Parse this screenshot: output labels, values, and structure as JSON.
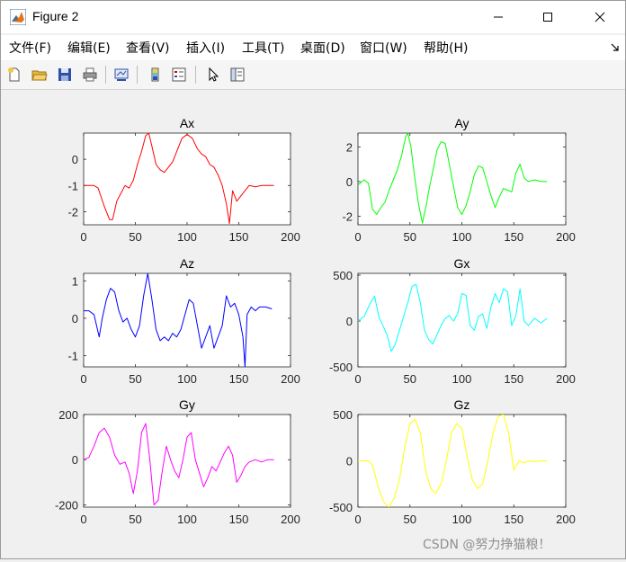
{
  "window": {
    "title": "Figure 2"
  },
  "menu": [
    "文件(F)",
    "编辑(E)",
    "查看(V)",
    "插入(I)",
    "工具(T)",
    "桌面(D)",
    "窗口(W)",
    "帮助(H)"
  ],
  "toolbar": [
    "new-figure-icon",
    "open-icon",
    "save-icon",
    "print-icon",
    "link-plot-icon",
    "insert-colorbar-icon",
    "insert-legend-icon",
    "edit-plot-arrow-icon",
    "property-inspector-icon"
  ],
  "watermark": "CSDN @努力挣猫粮！",
  "chart_data": [
    {
      "type": "line",
      "title": "Ax",
      "color": "#ff0000",
      "xlim": [
        0,
        200
      ],
      "ylim": [
        -2.5,
        1
      ],
      "xticks": [
        0,
        50,
        100,
        150,
        200
      ],
      "yticks": [
        -2,
        -1,
        0
      ],
      "x": [
        0,
        10,
        14,
        20,
        25,
        28,
        32,
        36,
        40,
        44,
        48,
        52,
        56,
        60,
        63,
        66,
        70,
        74,
        78,
        82,
        86,
        90,
        95,
        100,
        105,
        110,
        114,
        118,
        122,
        126,
        130,
        134,
        138,
        141,
        144,
        148,
        152,
        156,
        160,
        166,
        172,
        178,
        184
      ],
      "y": [
        -1,
        -1,
        -1.1,
        -1.8,
        -2.3,
        -2.3,
        -1.6,
        -1.3,
        -1,
        -1.1,
        -0.8,
        -0.2,
        0.3,
        0.9,
        1,
        0.5,
        -0.2,
        -0.4,
        -0.5,
        -0.3,
        -0.1,
        0.3,
        0.8,
        0.95,
        0.8,
        0.4,
        0.2,
        0.1,
        -0.2,
        -0.3,
        -0.6,
        -1,
        -1.7,
        -2.45,
        -1.2,
        -1.6,
        -1.4,
        -1.2,
        -1,
        -1.05,
        -1,
        -1,
        -1
      ]
    },
    {
      "type": "line",
      "title": "Ay",
      "color": "#00ff00",
      "xlim": [
        0,
        200
      ],
      "ylim": [
        -2.5,
        2.8
      ],
      "xticks": [
        0,
        50,
        100,
        150,
        200
      ],
      "yticks": [
        -2,
        0,
        2
      ],
      "x": [
        0,
        6,
        10,
        14,
        18,
        22,
        26,
        30,
        34,
        38,
        42,
        46,
        48,
        51,
        54,
        58,
        62,
        66,
        68,
        72,
        76,
        80,
        84,
        88,
        92,
        96,
        100,
        104,
        108,
        112,
        116,
        120,
        124,
        128,
        132,
        136,
        140,
        144,
        148,
        152,
        156,
        160,
        164,
        170,
        176,
        182
      ],
      "y": [
        -0.2,
        0.1,
        -0.1,
        -1.6,
        -1.9,
        -1.5,
        -1.2,
        -0.5,
        0.1,
        0.7,
        1.5,
        2.6,
        2.8,
        2,
        0.5,
        -1.2,
        -2.4,
        -1.3,
        -0.6,
        0.6,
        1.8,
        2.3,
        2.2,
        1,
        -0.3,
        -1.5,
        -1.9,
        -1.4,
        -0.6,
        0.4,
        0.9,
        0.8,
        0,
        -0.8,
        -1.5,
        -0.9,
        -0.4,
        -0.5,
        -0.6,
        0.5,
        1,
        0.2,
        0,
        0.1,
        0,
        0
      ]
    },
    {
      "type": "line",
      "title": "Az",
      "color": "#0000ff",
      "xlim": [
        0,
        200
      ],
      "ylim": [
        -1.3,
        1.2
      ],
      "xticks": [
        0,
        50,
        100,
        150,
        200
      ],
      "yticks": [
        -1,
        0,
        1
      ],
      "x": [
        0,
        5,
        10,
        15,
        18,
        22,
        26,
        30,
        34,
        38,
        42,
        46,
        50,
        54,
        58,
        62,
        66,
        70,
        74,
        78,
        82,
        86,
        90,
        94,
        98,
        102,
        106,
        110,
        114,
        118,
        122,
        126,
        130,
        134,
        138,
        142,
        146,
        150,
        154,
        156,
        158,
        162,
        166,
        170,
        176,
        182
      ],
      "y": [
        0.2,
        0.2,
        0.1,
        -0.5,
        0,
        0.5,
        0.8,
        0.7,
        0.2,
        -0.1,
        0,
        -0.3,
        -0.5,
        -0.2,
        0.6,
        1.2,
        0.5,
        -0.3,
        -0.6,
        -0.5,
        -0.6,
        -0.4,
        -0.5,
        -0.3,
        0.1,
        0.5,
        0.4,
        -0.2,
        -0.8,
        -0.5,
        -0.2,
        -0.8,
        -0.5,
        -0.2,
        0.6,
        0.3,
        0.4,
        0.1,
        -0.5,
        -1.3,
        0.1,
        0.3,
        0.2,
        0.3,
        0.3,
        0.25
      ]
    },
    {
      "type": "line",
      "title": "Gx",
      "color": "#00ffff",
      "xlim": [
        0,
        200
      ],
      "ylim": [
        -500,
        520
      ],
      "xticks": [
        0,
        50,
        100,
        150,
        200
      ],
      "yticks": [
        -500,
        0,
        500
      ],
      "x": [
        0,
        6,
        12,
        16,
        20,
        24,
        28,
        32,
        36,
        40,
        44,
        48,
        52,
        56,
        60,
        64,
        68,
        72,
        76,
        80,
        84,
        88,
        92,
        96,
        100,
        104,
        108,
        112,
        116,
        120,
        124,
        128,
        132,
        136,
        140,
        144,
        148,
        152,
        156,
        160,
        164,
        170,
        176,
        182
      ],
      "y": [
        0,
        50,
        200,
        270,
        50,
        -50,
        -150,
        -330,
        -250,
        -100,
        50,
        200,
        380,
        400,
        200,
        -100,
        -200,
        -250,
        -150,
        -50,
        30,
        60,
        0,
        80,
        300,
        280,
        -50,
        -100,
        50,
        80,
        -80,
        150,
        300,
        200,
        350,
        320,
        -50,
        60,
        350,
        0,
        -50,
        30,
        -20,
        30
      ]
    },
    {
      "type": "line",
      "title": "Gy",
      "color": "#ff00ff",
      "xlim": [
        0,
        200
      ],
      "ylim": [
        -210,
        200
      ],
      "xticks": [
        0,
        50,
        100,
        150,
        200
      ],
      "yticks": [
        -200,
        0,
        200
      ],
      "x": [
        0,
        5,
        10,
        15,
        20,
        25,
        30,
        35,
        40,
        44,
        48,
        52,
        56,
        60,
        64,
        68,
        72,
        76,
        80,
        84,
        88,
        92,
        96,
        100,
        104,
        108,
        112,
        116,
        120,
        124,
        128,
        132,
        136,
        140,
        144,
        148,
        152,
        156,
        160,
        166,
        172,
        178,
        184
      ],
      "y": [
        0,
        10,
        60,
        120,
        140,
        100,
        20,
        -20,
        -10,
        -60,
        -150,
        -50,
        120,
        160,
        0,
        -200,
        -180,
        -50,
        60,
        0,
        -50,
        -80,
        0,
        100,
        120,
        0,
        -60,
        -120,
        -80,
        -30,
        -50,
        -10,
        30,
        60,
        20,
        -100,
        -70,
        -30,
        -10,
        0,
        -10,
        0,
        0
      ]
    },
    {
      "type": "line",
      "title": "Gz",
      "color": "#ffff00",
      "xlim": [
        0,
        200
      ],
      "ylim": [
        -500,
        500
      ],
      "xticks": [
        0,
        50,
        100,
        150,
        200
      ],
      "yticks": [
        -500,
        0,
        500
      ],
      "x": [
        0,
        10,
        14,
        20,
        25,
        30,
        35,
        40,
        45,
        50,
        55,
        60,
        65,
        70,
        75,
        80,
        85,
        90,
        95,
        100,
        105,
        110,
        115,
        120,
        125,
        130,
        135,
        140,
        145,
        150,
        155,
        160,
        165,
        170,
        176,
        182
      ],
      "y": [
        0,
        0,
        -50,
        -300,
        -450,
        -500,
        -400,
        -200,
        150,
        400,
        450,
        300,
        -100,
        -300,
        -350,
        -250,
        0,
        300,
        400,
        350,
        50,
        -200,
        -300,
        -250,
        0,
        300,
        480,
        500,
        300,
        -100,
        0,
        -20,
        0,
        -10,
        0,
        0
      ]
    }
  ]
}
